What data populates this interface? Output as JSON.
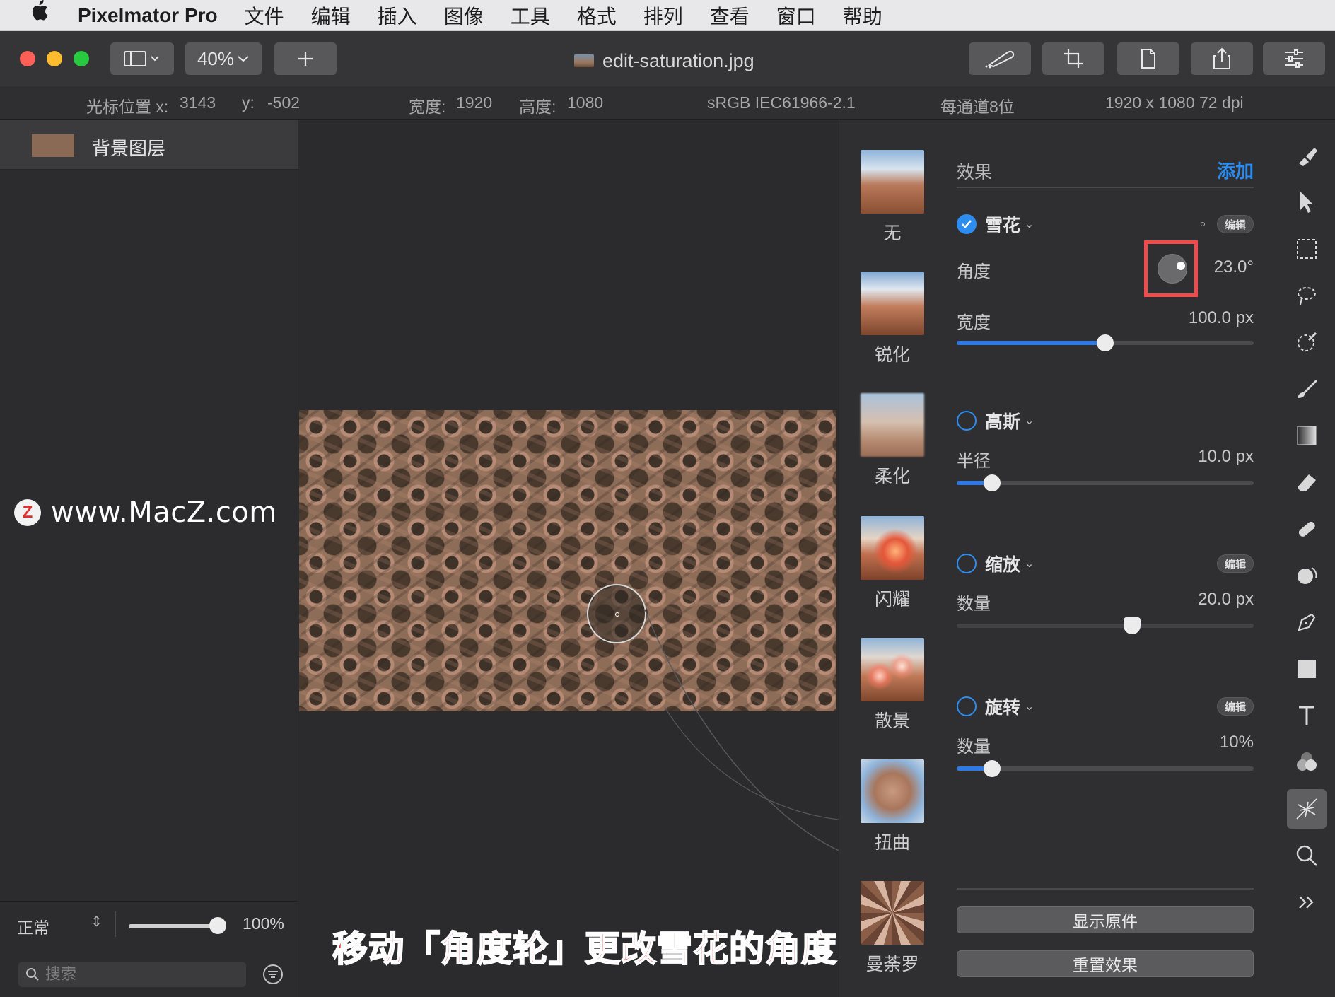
{
  "menubar": {
    "app_name": "Pixelmator Pro",
    "items": [
      "文件",
      "编辑",
      "插入",
      "图像",
      "工具",
      "格式",
      "排列",
      "查看",
      "窗口",
      "帮助"
    ]
  },
  "toolbar": {
    "zoom": "40%",
    "document_title": "edit-saturation.jpg",
    "traffic_colors": [
      "#fe5f57",
      "#febc2e",
      "#28c840"
    ]
  },
  "infobar": {
    "cursor_label": "光标位置 x:",
    "cursor_x": "3143",
    "cursor_y_label": "y:",
    "cursor_y": "-502",
    "width_label": "宽度:",
    "width": "1920",
    "height_label": "高度:",
    "height": "1080",
    "color_profile": "sRGB IEC61966-2.1",
    "bit_depth": "每通道8位",
    "dimensions": "1920 x 1080 72 dpi"
  },
  "layers": {
    "layer_name": "背景图层",
    "blend_mode": "正常",
    "opacity": "100%",
    "opacity_fraction": 1.0,
    "search_placeholder": "搜索"
  },
  "watermark": {
    "logo_letter": "Z",
    "text": "www.MacZ.com"
  },
  "caption": "移动「角度轮」更改雪花的角度",
  "effects": {
    "title": "效果",
    "add_label": "添加",
    "categories": [
      "无",
      "锐化",
      "柔化",
      "闪耀",
      "散景",
      "扭曲",
      "曼荼罗"
    ],
    "edit_label": "编辑",
    "snowflake": {
      "name": "雪花",
      "enabled": true,
      "angle_label": "角度",
      "angle_value": "23.0°",
      "angle_degrees": 23.0,
      "width_label": "宽度",
      "width_value": "100.0 px",
      "width_fraction": 0.5
    },
    "gaussian": {
      "name": "高斯",
      "enabled": false,
      "radius_label": "半径",
      "radius_value": "10.0 px",
      "radius_fraction": 0.12
    },
    "zoom": {
      "name": "缩放",
      "enabled": false,
      "amount_label": "数量",
      "amount_value": "20.0 px",
      "amount_fraction": 0.59
    },
    "twirl": {
      "name": "旋转",
      "enabled": false,
      "amount_label": "数量",
      "amount_value": "10%",
      "amount_fraction": 0.12
    },
    "show_original": "显示原件",
    "reset_effects": "重置效果",
    "accent_color": "#2d8cf0"
  }
}
